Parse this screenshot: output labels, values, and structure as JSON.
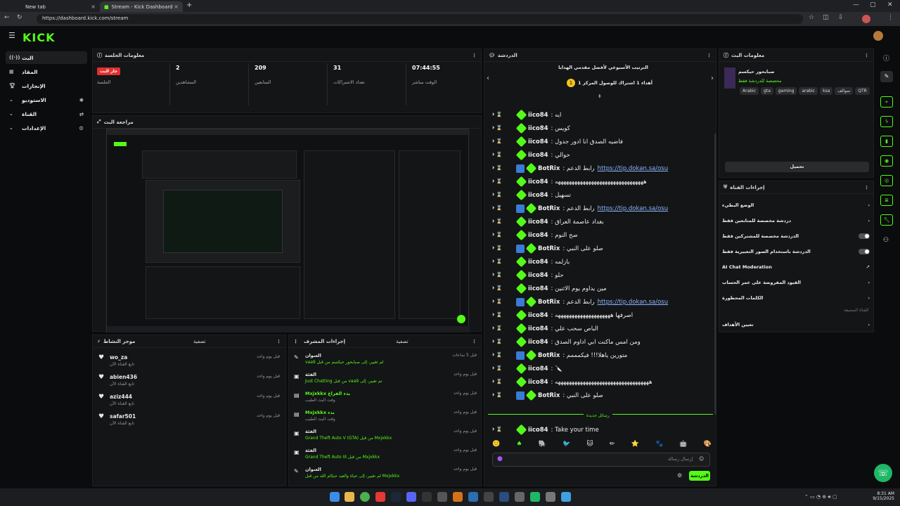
{
  "browser": {
    "tabs": [
      {
        "label": "New tab"
      },
      {
        "label": "Stream - Kick Dashboard"
      }
    ],
    "url": "https://dashboard.kick.com/stream"
  },
  "brand": {
    "logo": "KICK",
    "accent": "#53fc18"
  },
  "sidebar": {
    "items": [
      {
        "label": "البث",
        "icon": "broadcast-icon"
      },
      {
        "label": "المقاد",
        "icon": "grid-icon"
      },
      {
        "label": "الإنجازات",
        "icon": "trophy-icon"
      },
      {
        "label": "الاستوديو",
        "icon": "studio-icon"
      },
      {
        "label": "القناة",
        "icon": "channel-icon"
      },
      {
        "label": "الإعدادات",
        "icon": "gear-icon"
      }
    ]
  },
  "session": {
    "title": "معلومات الجلسة",
    "live_badge": "جار البث",
    "live_label": "الجلسة",
    "stats": [
      {
        "value": "2",
        "label": "المشاهدين"
      },
      {
        "value": "209",
        "label": "المتابعين"
      },
      {
        "value": "31",
        "label": "تعداد الاشتراكات"
      },
      {
        "value": "07:44:55",
        "label": "الوقت مباشر"
      }
    ]
  },
  "preview": {
    "title": "مراجعة البث"
  },
  "activity": {
    "title": "موجز النشاط",
    "filter": "تصفية",
    "items": [
      {
        "user": "wo_za",
        "action": "تابع القناة الآن",
        "time": "قبل يوم واحد"
      },
      {
        "user": "abien436",
        "action": "تابع القناة الآن",
        "time": "قبل يوم واحد"
      },
      {
        "user": "aziz444",
        "action": "تابع القناة الآن",
        "time": "قبل يوم واحد"
      },
      {
        "user": "safar501",
        "action": "تابع القناة الآن",
        "time": "قبل يوم واحد"
      }
    ]
  },
  "modactions": {
    "title": "إجراءات المشرف",
    "filter": "تصفية",
    "items": [
      {
        "head": "العنوان",
        "line": "vaa9 لم تغيير، إلى صبابحور حيكسم من قبل",
        "time": "قبل 5 ساعات"
      },
      {
        "head": "الفئة",
        "line": "Just Chatting من قبل vaa9 تم تغيير، إلى",
        "time": "قبل يوم واحد"
      },
      {
        "head": "Mxjxkkx بدء الفراغ",
        "line": "وقت البث الطيب",
        "time": "قبل يوم واحد"
      },
      {
        "head": "Mxjxkkx بدء",
        "line": "وقت البث الطيب",
        "time": "قبل يوم واحد"
      },
      {
        "head": "الفئة",
        "line": "Grand Theft Auto V (GTA) من قبل Mxjxkkx",
        "time": "قبل يوم واحد"
      },
      {
        "head": "الفئة",
        "line": "Grand Theft Auto III من قبل Mxjxkkx",
        "time": "قبل يوم واحد"
      },
      {
        "head": "العنوان",
        "line": "لم تغيير، إلى حياة والعيد حيكام الله من قبل Mxjxkkx",
        "time": "قبل يوم واحد"
      }
    ]
  },
  "chat": {
    "title": "الدردشة",
    "leaderboard_title": "الترتيب الأسبوعي لأفضل مقدمي الهدايا",
    "leaderboard_line": "أهداء 1 اشتراك للوصول المركز 1",
    "new_messages": "رسائل جديدة",
    "input_placeholder": "إرسال رسالة",
    "send": "الدردشة",
    "messages": [
      {
        "user": "iico84",
        "text": "ايه",
        "bot": false
      },
      {
        "user": "iico84",
        "text": "كويس",
        "bot": false
      },
      {
        "user": "iico84",
        "text": "فاضيه الصدق انا ادور جدول",
        "bot": false
      },
      {
        "user": "iico84",
        "text": "حوالي",
        "bot": false
      },
      {
        "user": "BotRix",
        "text": "https://tip.dokan.sa/osu",
        "pre": "رابط الدعم",
        "bot": true
      },
      {
        "user": "iico84",
        "text": "ههههههههههههههههههههههههههههههههه",
        "bot": false
      },
      {
        "user": "iico84",
        "text": "تسهيل",
        "bot": false
      },
      {
        "user": "BotRix",
        "text": "https://tip.dokan.sa/osu",
        "pre": "رابط الدعم",
        "bot": true
      },
      {
        "user": "iico84",
        "text": "بغداد عاصمة العراق",
        "bot": false
      },
      {
        "user": "iico84",
        "text": "صح النوم",
        "bot": false
      },
      {
        "user": "BotRix",
        "text": "صلو على النبي",
        "bot": true
      },
      {
        "user": "iico84",
        "text": "بازلمه",
        "bot": false
      },
      {
        "user": "iico84",
        "text": "حلو",
        "bot": false
      },
      {
        "user": "iico84",
        "text": "مين يداوم يوم الاثنين",
        "bot": false
      },
      {
        "user": "BotRix",
        "text": "https://tip.dokan.sa/osu",
        "pre": "رابط الدعم",
        "bot": true
      },
      {
        "user": "iico84",
        "text": "اصرفها ههههههههههههههههههههه",
        "bot": false
      },
      {
        "user": "iico84",
        "text": "الباص سحب علي",
        "bot": false
      },
      {
        "user": "iico84",
        "text": "ومن امس ماكنت ابي اداوم الصدق",
        "bot": false
      },
      {
        "user": "BotRix",
        "text": "متورين ياهلا!!! فيكمممم",
        "bot": true
      },
      {
        "user": "iico84",
        "text": "🔪",
        "bot": false
      },
      {
        "user": "iico84",
        "text": "ههههههههههههههههههههههههههههههههههه",
        "bot": false
      },
      {
        "user": "BotRix",
        "text": "صلو على النبي",
        "bot": true
      }
    ],
    "last": {
      "user": "iico84",
      "text": "Take your time"
    }
  },
  "streaminfo": {
    "title": "معلومات البث",
    "channel": "صبابحور حيكسم",
    "subtitle": "مخصصة للدردشة فقط",
    "tags": [
      "Arabic",
      "gta",
      "gaming",
      "arabic",
      "ksa",
      "سوالف",
      "QTR"
    ],
    "edit": "تحميل"
  },
  "channelactions": {
    "title": "إجراءات القناة",
    "rows": [
      {
        "label": "الوضع البطيء",
        "type": "chevron"
      },
      {
        "label": "دردشة مخصصة للمتابعين فقط",
        "type": "chevron"
      },
      {
        "label": "الدردشة مخصصة للمشتركين فقط",
        "type": "toggle"
      },
      {
        "label": "الدردشة باستخدام الصور التعبيرية فقط",
        "type": "toggle"
      },
      {
        "label": "AI Chat Moderation",
        "type": "link"
      },
      {
        "label": "القيود المفروضة على عمر الحساب",
        "type": "chevron"
      },
      {
        "label": "الكلمات المحظورة",
        "type": "chevron"
      },
      {
        "label": "تعيين الأهداف",
        "type": "chevron"
      }
    ],
    "sub": "القناة المضيفة"
  },
  "taskbar": {
    "time": "8:31 AM",
    "date": "9/15/2025"
  }
}
